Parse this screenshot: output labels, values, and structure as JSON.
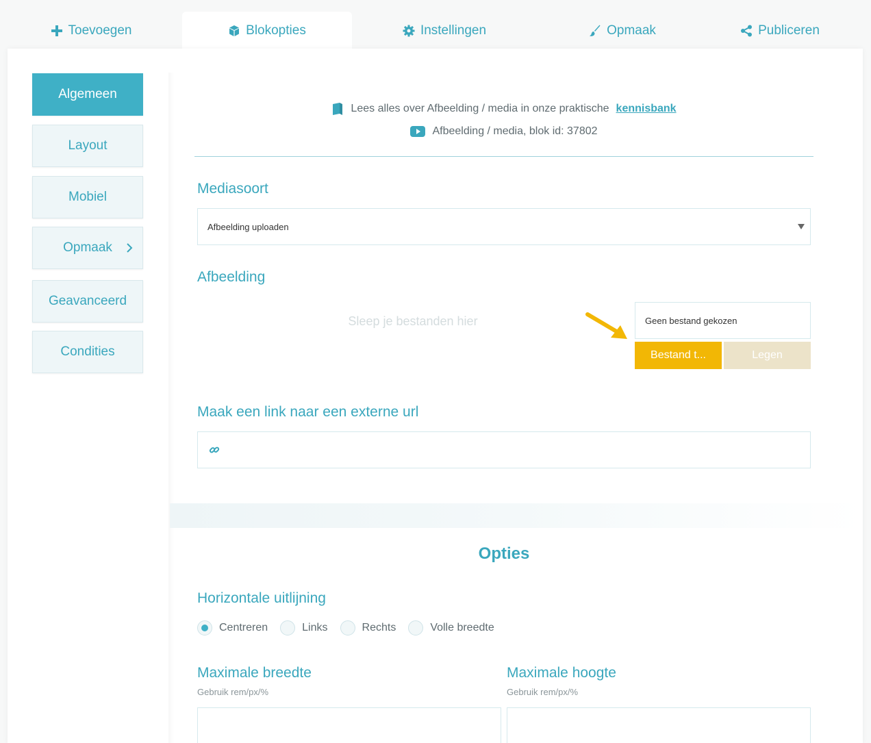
{
  "tabs": [
    {
      "label": "Toevoegen",
      "icon": "plus-icon"
    },
    {
      "label": "Blokopties",
      "icon": "cube-icon"
    },
    {
      "label": "Instellingen",
      "icon": "gear-icon"
    },
    {
      "label": "Opmaak",
      "icon": "brush-icon"
    },
    {
      "label": "Publiceren",
      "icon": "share-icon"
    }
  ],
  "active_tab": "Blokopties",
  "sidebar": {
    "items": [
      {
        "label": "Algemeen"
      },
      {
        "label": "Layout"
      },
      {
        "label": "Mobiel"
      },
      {
        "label": "Opmaak"
      },
      {
        "label": "Geavanceerd"
      },
      {
        "label": "Condities"
      }
    ],
    "active": "Algemeen"
  },
  "info": {
    "read_prefix": "Lees alles over Afbeelding / media in onze praktische",
    "kb_link": "kennisbank",
    "block_id_text": "Afbeelding / media, blok id: 37802"
  },
  "form": {
    "mediasoort_label": "Mediasoort",
    "mediasoort_value": "Afbeelding uploaden",
    "afbeelding_label": "Afbeelding",
    "dropzone_text": "Sleep je bestanden hier",
    "file_status": "Geen bestand gekozen",
    "choose_button": "Bestand t...",
    "clear_button": "Legen",
    "link_label": "Maak een link naar een externe url",
    "link_value": ""
  },
  "options": {
    "title": "Opties",
    "alignment_label": "Horizontale uitlijning",
    "alignment_options": [
      "Centreren",
      "Links",
      "Rechts",
      "Volle breedte"
    ],
    "alignment_selected": "Centreren",
    "max_width_label": "Maximale breedte",
    "max_width_hint": "Gebruik rem/px/%",
    "max_height_label": "Maximale hoogte",
    "max_height_hint": "Gebruik rem/px/%"
  },
  "colors": {
    "accent": "#3aa7bd",
    "highlight": "#f2b705",
    "disabled": "#ece3c9"
  }
}
